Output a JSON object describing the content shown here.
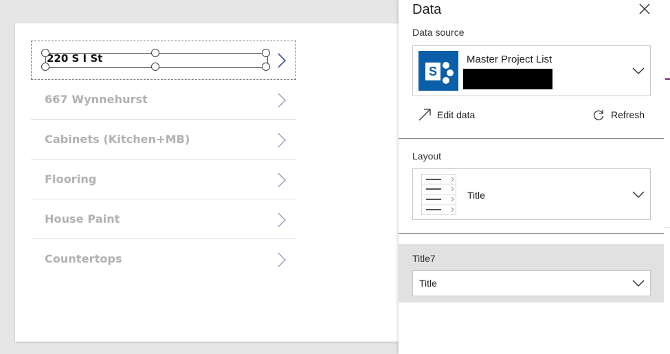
{
  "gallery": {
    "selected_item": "220 S I St",
    "items": [
      {
        "title": "667 Wynnehurst"
      },
      {
        "title": "Cabinets (Kitchen+MB)"
      },
      {
        "title": "Flooring"
      },
      {
        "title": "House Paint"
      },
      {
        "title": "Countertops"
      }
    ]
  },
  "panel": {
    "title": "Data",
    "data_source_label": "Data source",
    "data_source_name": "Master Project List",
    "data_source_icon": "sharepoint-icon",
    "edit_data_label": "Edit data",
    "refresh_label": "Refresh",
    "layout_label": "Layout",
    "layout_value": "Title",
    "field_label": "Title7",
    "field_value": "Title"
  },
  "colors": {
    "sharepoint_blue": "#0b5ea8",
    "chevron_blue": "#6b78b8",
    "accent_purple": "#742774"
  }
}
